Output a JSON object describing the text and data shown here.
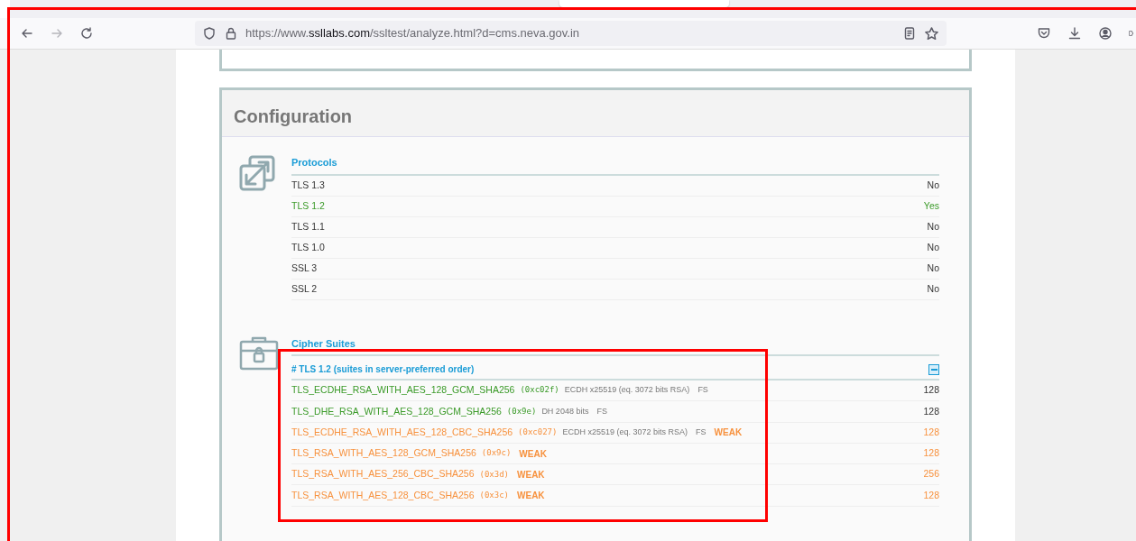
{
  "browser": {
    "nav_buttons": [
      {
        "kind": "back",
        "disabled": false
      },
      {
        "kind": "forward",
        "disabled": true
      },
      {
        "kind": "reload",
        "disabled": false
      }
    ],
    "address": {
      "prefix": "https://www.",
      "domain": "ssllabs.com",
      "path": "/ssltest/analyze.html?d=cms.neva.gov.in"
    }
  },
  "panel": {
    "title": "Configuration",
    "protocols": {
      "title": "Protocols",
      "rows": [
        {
          "name": "TLS 1.3",
          "value": "No",
          "supported": false
        },
        {
          "name": "TLS 1.2",
          "value": "Yes",
          "supported": true
        },
        {
          "name": "TLS 1.1",
          "value": "No",
          "supported": false
        },
        {
          "name": "TLS 1.0",
          "value": "No",
          "supported": false
        },
        {
          "name": "SSL 3",
          "value": "No",
          "supported": false
        },
        {
          "name": "SSL 2",
          "value": "No",
          "supported": false
        }
      ]
    },
    "cipher_suites": {
      "title": "Cipher Suites",
      "group": "# TLS 1.2 (suites in server-preferred order)",
      "expanded": true,
      "rows": [
        {
          "name": "TLS_ECDHE_RSA_WITH_AES_128_GCM_SHA256",
          "code": "(0xc02f)",
          "details": [
            "ECDH x25519 (eq. 3072 bits RSA)",
            "FS"
          ],
          "weak": false,
          "bits": "128"
        },
        {
          "name": "TLS_DHE_RSA_WITH_AES_128_GCM_SHA256",
          "code": "(0x9e)",
          "details": [
            "DH 2048 bits",
            "FS"
          ],
          "weak": false,
          "bits": "128"
        },
        {
          "name": "TLS_ECDHE_RSA_WITH_AES_128_CBC_SHA256",
          "code": "(0xc027)",
          "details": [
            "ECDH x25519 (eq. 3072 bits RSA)",
            "FS"
          ],
          "weak": true,
          "label": "WEAK",
          "bits": "128"
        },
        {
          "name": "TLS_RSA_WITH_AES_128_GCM_SHA256",
          "code": "(0x9c)",
          "details": [],
          "weak": true,
          "label": "WEAK",
          "bits": "128"
        },
        {
          "name": "TLS_RSA_WITH_AES_256_CBC_SHA256",
          "code": "(0x3d)",
          "details": [],
          "weak": true,
          "label": "WEAK",
          "bits": "256"
        },
        {
          "name": "TLS_RSA_WITH_AES_128_CBC_SHA256",
          "code": "(0x3c)",
          "details": [],
          "weak": true,
          "label": "WEAK",
          "bits": "128"
        }
      ]
    }
  }
}
